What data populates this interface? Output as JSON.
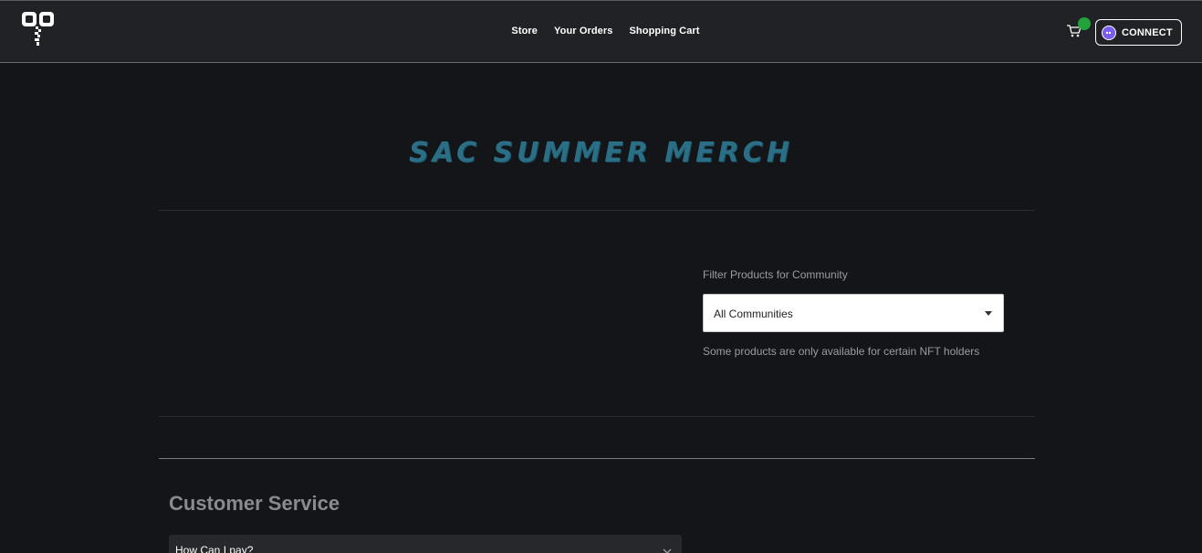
{
  "nav": {
    "links": [
      {
        "label": "Store"
      },
      {
        "label": "Your Orders"
      },
      {
        "label": "Shopping Cart"
      }
    ],
    "connect_label": "CONNECT",
    "accent_green": "#21a33a"
  },
  "hero": {
    "title": "SAC SUMMER MERCH",
    "color": "#2a6f86"
  },
  "filter": {
    "label": "Filter Products for Community",
    "selected": "All Communities",
    "help": "Some products are only available for certain NFT holders"
  },
  "customer_service": {
    "title": "Customer Service",
    "faq": [
      {
        "question": "How Can I pay?"
      }
    ]
  },
  "icons": [
    "logo-icon",
    "cart-icon",
    "wallet-icon",
    "chevron-down-icon"
  ]
}
